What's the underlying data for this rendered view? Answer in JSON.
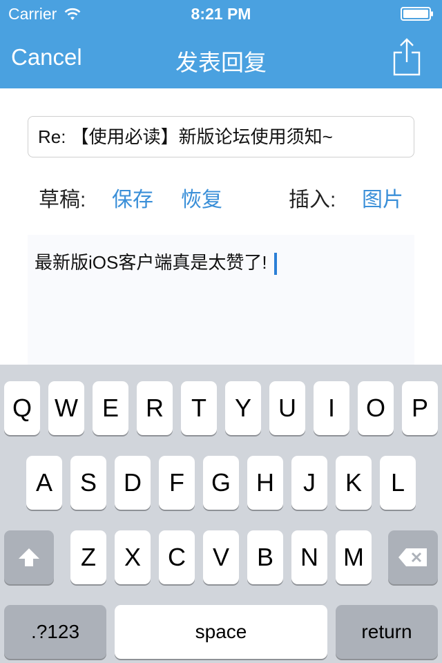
{
  "status_bar": {
    "carrier": "Carrier",
    "time": "8:21 PM"
  },
  "nav": {
    "cancel_label": "Cancel",
    "title": "发表回复"
  },
  "subject": {
    "value": "Re: 【使用必读】新版论坛使用须知~"
  },
  "draft": {
    "label": "草稿:",
    "save": "保存",
    "restore": "恢复"
  },
  "insert": {
    "label": "插入:",
    "image": "图片"
  },
  "body": {
    "text": "最新版iOS客户端真是太赞了!"
  },
  "keyboard": {
    "row1": [
      "Q",
      "W",
      "E",
      "R",
      "T",
      "Y",
      "U",
      "I",
      "O",
      "P"
    ],
    "row2": [
      "A",
      "S",
      "D",
      "F",
      "G",
      "H",
      "J",
      "K",
      "L"
    ],
    "row3": [
      "Z",
      "X",
      "C",
      "V",
      "B",
      "N",
      "M"
    ],
    "numbers": ".?123",
    "space": "space",
    "return": "return"
  },
  "colors": {
    "nav_bar": "#4aa1e0",
    "link": "#3a8fd8",
    "keyboard_bg": "#d1d5db"
  },
  "icons": {
    "wifi": "wifi-icon",
    "battery": "battery-icon",
    "share": "share-icon",
    "shift": "shift-icon",
    "delete": "delete-icon"
  }
}
